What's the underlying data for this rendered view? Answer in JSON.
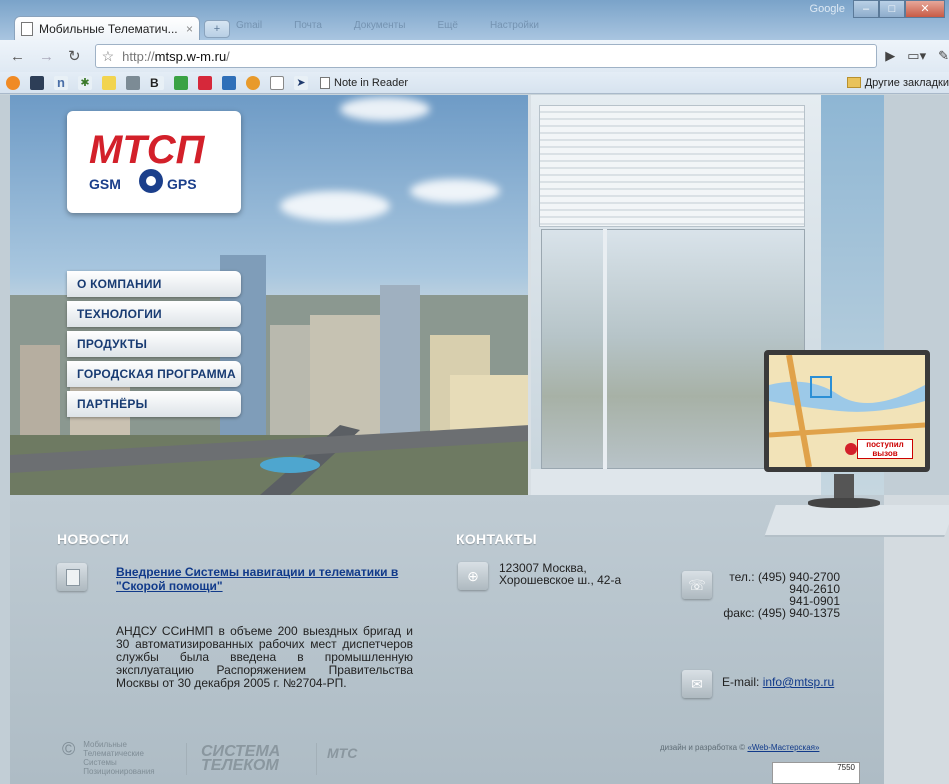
{
  "browser": {
    "tab_title": "Мобильные Телематич...",
    "tab_close": "×",
    "new_tab": "+",
    "url_prefix": "http://",
    "url_host": "mtsp.w-m.ru",
    "url_suffix": "/",
    "blurred_tabs": [
      "Google",
      "Gmail",
      "Почта",
      "Документы",
      "Ещё",
      "Настройки"
    ],
    "window_google": "Google",
    "bookmark_note": "Note in Reader",
    "bookmark_other": "Другие закладки"
  },
  "menu": {
    "items": [
      "О компании",
      "Технологии",
      "Продукты",
      "Городская программа",
      "Партнёры"
    ]
  },
  "logo": {
    "top": "МТСП",
    "left_word": "GSM",
    "right_word": "GPS"
  },
  "monitor": {
    "label_line1": "поступил",
    "label_line2": "вызов"
  },
  "news": {
    "title": "НОВОСТИ",
    "link": "Внедрение Системы навигации и телематики в \"Скорой помощи\"",
    "body": "АНДСУ ССиНМП в объеме 200 выездных бригад и 30 автоматизированных рабочих мест диспетчеров службы была введена в промышленную эксплуатацию Распоряжением Правительства Москвы от 30 декабря 2005 г. №2704-РП."
  },
  "contacts": {
    "title": "КОНТАКТЫ",
    "address_line1": "123007 Москва,",
    "address_line2": "Хорошевское ш., 42-а",
    "phone1": "тел.: (495) 940-2700",
    "phone2": "940-2610",
    "phone3": "941-0901",
    "fax": "факс: (495) 940-1375",
    "email_label": "E-mail:",
    "email": "info@mtsp.ru"
  },
  "footer": {
    "copyright_symbol": "©",
    "company_line1": "Мобильные",
    "company_line2": "Телематические",
    "company_line3": "Системы",
    "company_line4": "Позиционирования",
    "partner_line1": "СИСТЕМА",
    "partner_line2": "ТЕЛЕКОМ",
    "mtsp_mark": "МТС",
    "design_text": "дизайн и разработка ©",
    "design_link": "«Web-Мастерская»",
    "counter": "7550"
  },
  "colors": {
    "menu_text": "#183b72",
    "link": "#113a8a",
    "logo_red": "#d3202a",
    "logo_blue": "#1b3f8b"
  }
}
